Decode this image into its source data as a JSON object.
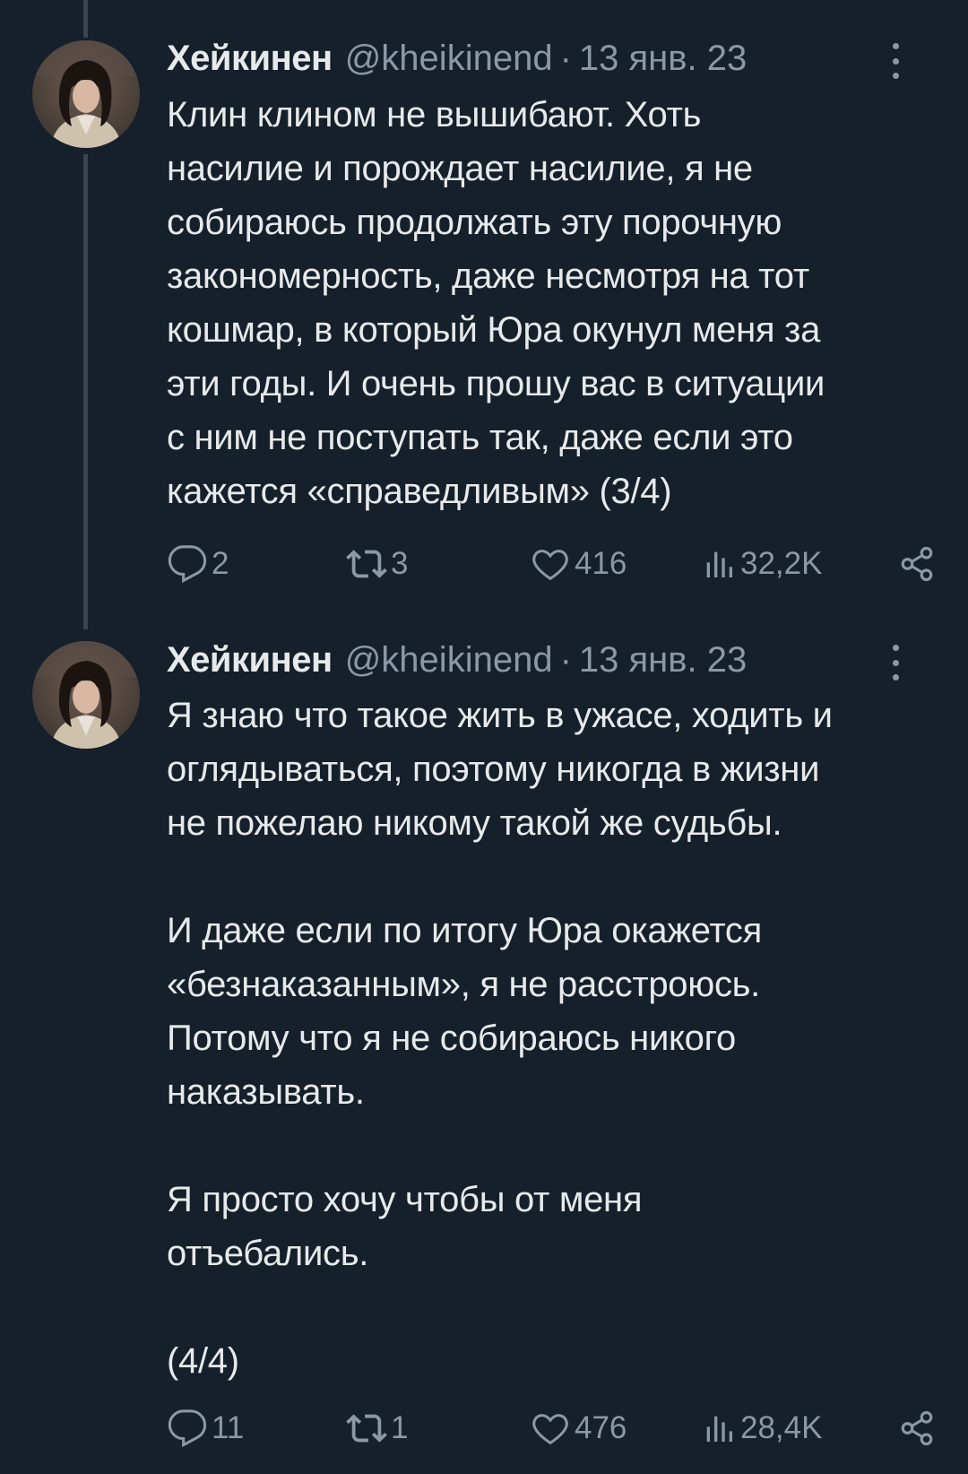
{
  "tweets": [
    {
      "author": {
        "name": "Хейкинен",
        "handle": "@kheikinend"
      },
      "separator": "·",
      "date": "13 янв. 23",
      "text": "Клин клином не вышибают. Хоть\nнасилие и порождает насилие, я не\nсобираюсь продолжать эту порочную\nзакономерность, даже несмотря на тот\nкошмар, в который Юра окунул меня за\nэти годы. И очень прошу вас в ситуации\nс ним не поступать так, даже если это\nкажется «справедливым» (3/4)",
      "stats": {
        "replies": "2",
        "retweets": "3",
        "likes": "416",
        "views": "32,2K"
      }
    },
    {
      "author": {
        "name": "Хейкинен",
        "handle": "@kheikinend"
      },
      "separator": "·",
      "date": "13 янв. 23",
      "text": "Я знаю что такое жить в ужасе, ходить и\nоглядываться, поэтому никогда в жизни\nне пожелаю никому такой же судьбы.\n\nИ даже если по итогу Юра окажется\n«безнаказанным», я не расстроюсь.\nПотому что я не собираюсь никого\nнаказывать.\n\nЯ просто хочу чтобы от меня\nотъебались.\n\n(4/4)",
      "stats": {
        "replies": "11",
        "retweets": "1",
        "likes": "476",
        "views": "28,4K"
      }
    }
  ],
  "colors": {
    "background": "#15202b",
    "text": "#e7e9ea",
    "secondary": "#8b98a5",
    "thread_line": "#3a4550"
  },
  "icons": {
    "reply": "speech-bubble-icon",
    "retweet": "retweet-arrows-icon",
    "like": "heart-outline-icon",
    "views": "bar-chart-icon",
    "share": "share-nodes-icon",
    "more": "vertical-dots-icon"
  }
}
